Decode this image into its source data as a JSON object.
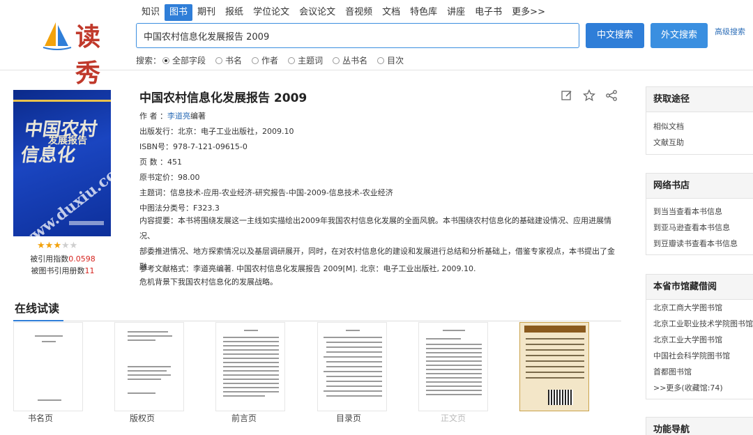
{
  "brand": {
    "logo_text": "读秀"
  },
  "nav": {
    "items": [
      "知识",
      "图书",
      "期刊",
      "报纸",
      "学位论文",
      "会议论文",
      "音视频",
      "文档",
      "特色库",
      "讲座",
      "电子书",
      "更多>>"
    ],
    "active": "图书"
  },
  "search": {
    "query": "中国农村信息化发展报告 2009",
    "cn_button": "中文搜索",
    "en_button": "外文搜索",
    "advanced": "高级搜索",
    "scope_label": "搜索：",
    "scopes": [
      "全部字段",
      "书名",
      "作者",
      "主题词",
      "丛书名",
      "目次"
    ],
    "selected_scope": "全部字段"
  },
  "book": {
    "cover": {
      "title_line1": "中国农村信息化",
      "title_line2": "发展报告",
      "watermark": "www.duxiu.com"
    },
    "rating": {
      "stars": 3,
      "max": 5
    },
    "cite_index_label": "被引用指数",
    "cite_index_value": "0.0598",
    "cite_books_label": "被图书引用册数",
    "cite_books_value": "11",
    "title": "中国农村信息化发展报告 2009",
    "author_label": "作 者 ：",
    "author_name": "李道亮",
    "author_suffix": "编著",
    "publisher": "出版发行：北京：电子工业出版社，2009.10",
    "isbn": "ISBN号：978-7-121-09615-0",
    "pages": "页 数 ：451",
    "price": "原书定价：98.00",
    "subjects": "主题词：信息技术-应用-农业经济-研究报告-中国-2009-信息技术-农业经济",
    "clc": "中图法分类号：F323.3",
    "summary_line1": "内容提要：本书将围绕发展这一主线如实描绘出2009年我国农村信息化发展的全面风貌。本书围绕农村信息化的基础建设情况、应用进展情况、",
    "summary_line2": "部委推进情况、地方探索情况以及基层调研展开，同时，在对农村信息化的建设和发展进行总结和分析基础上，借鉴专家视点，本书提出了金融",
    "summary_line3": "危机背景下我国农村信息化的发展战略。",
    "reference": "参考文献格式：李道亮编著. 中国农村信息化发展报告 2009[M]. 北京：电子工业出版社, 2009.10."
  },
  "reading": {
    "title": "在线试读",
    "pages": [
      "书名页",
      "版权页",
      "前言页",
      "目录页",
      "正文页"
    ]
  },
  "sidebar": {
    "access": {
      "title": "获取途径",
      "items": [
        "相似文档",
        "文献互助"
      ]
    },
    "stores": {
      "title": "网络书店",
      "items": [
        "到当当查看本书信息",
        "到亚马逊查看本书信息",
        "到豆瓣读书查看本书信息"
      ]
    },
    "libraries": {
      "title": "本省市馆藏借阅",
      "items": [
        "北京工商大学图书馆",
        "北京工业职业技术学院图书馆",
        "北京工业大学图书馆",
        "中国社会科学院图书馆",
        "首都图书馆",
        ">>更多(收藏馆:74)"
      ]
    },
    "functions": {
      "title": "功能导航"
    }
  },
  "colors": {
    "accent": "#2f7ed8",
    "highlight": "#d6241f",
    "link": "#2f6fb8"
  }
}
